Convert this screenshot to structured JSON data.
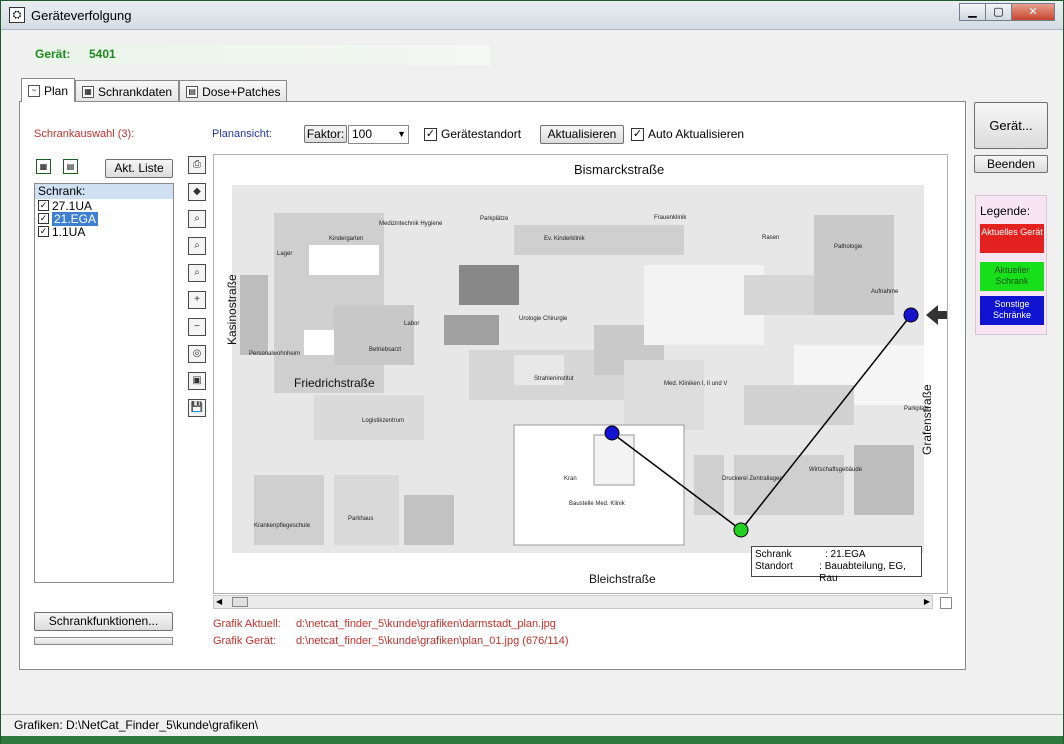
{
  "window": {
    "title": "Geräteverfolgung",
    "min": "▁",
    "max": "▢",
    "close": "✕"
  },
  "device": {
    "label": "Gerät:",
    "value": "5401"
  },
  "tabs": [
    {
      "label": "Plan",
      "icon": "plan-icon"
    },
    {
      "label": "Schrankdaten",
      "icon": "table-icon"
    },
    {
      "label": "Dose+Patches",
      "icon": "grid-icon"
    }
  ],
  "left": {
    "title": "Schrankauswahl (3):",
    "akt_liste": "Akt. Liste",
    "list_header": "Schrank:",
    "items": [
      "27.1UA",
      "21.EGA",
      "1.1UA"
    ],
    "selected": "21.EGA",
    "functions_button": "Schrankfunktionen..."
  },
  "toolbar": {
    "planansicht_label": "Planansicht:",
    "faktor_button": "Faktor:",
    "faktor_value": "100",
    "standort_label": "Gerätestandort",
    "aktualisieren": "Aktualisieren",
    "auto_label": "Auto Aktualisieren"
  },
  "map": {
    "streets": [
      "Bismarckstraße",
      "Kasinostraße",
      "Friedrichstraße",
      "Grafenstraße",
      "Bleichstraße"
    ],
    "buildings": [
      "Parkplätze",
      "Frauenklinik",
      "Urologie Chirurgie",
      "Strahleninstitut",
      "Ev. Kinderklinik",
      "Pathologie",
      "Aufnahme",
      "Rasen",
      "Med. Kliniken I, II und V",
      "Wirtschaftsgebäude",
      "Parkhaus",
      "Krankenpflegeschule",
      "Logistikzentrum",
      "Personalwohnheim",
      "Betriebsarzt",
      "Labor",
      "Lager",
      "Kindergarten",
      "Medizintechnik Hygiene",
      "Druckerei Zentrallager",
      "Baustelle Med. Klinik",
      "Kran",
      "Parkplatz"
    ],
    "tooltip": {
      "schrank_key": "Schrank",
      "schrank_val": ": 21.EGA",
      "standort_key": "Standort",
      "standort_val": ": Bauabteilung, EG, Rau"
    }
  },
  "info": {
    "aktuell_label": "Grafik Aktuell:",
    "aktuell_value": "d:\\netcat_finder_5\\kunde\\grafiken\\darmstadt_plan.jpg",
    "geraet_label": "Grafik Gerät:",
    "geraet_value": "d:\\netcat_finder_5\\kunde\\grafiken\\plan_01.jpg   (676/114)"
  },
  "right": {
    "geraet_button": "Gerät...",
    "beenden": "Beenden",
    "legend_title": "Legende:",
    "legend": [
      {
        "label": "Aktuelles Gerät",
        "color": "#e3221f"
      },
      {
        "label": "Aktueller Schrank",
        "color": "#17e01a"
      },
      {
        "label": "Sonstige Schränke",
        "color": "#0e14cf"
      }
    ]
  },
  "status": {
    "text": "Grafiken: D:\\NetCat_Finder_5\\kunde\\grafiken\\"
  }
}
